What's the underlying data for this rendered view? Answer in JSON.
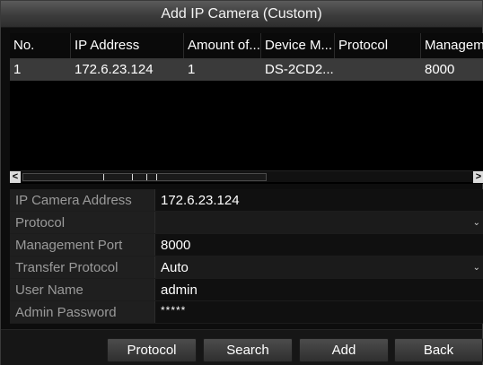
{
  "dialog": {
    "title": "Add IP Camera (Custom)"
  },
  "table": {
    "columns": [
      "No.",
      "IP Address",
      "Amount of...",
      "Device M...",
      "Protocol",
      "Managem"
    ],
    "rows": [
      [
        "1",
        "172.6.23.124",
        "1",
        "DS-2CD2...",
        "",
        "8000"
      ]
    ]
  },
  "scrollbar": {
    "left_arrow": "<",
    "right_arrow": ">"
  },
  "form": {
    "ip_address": {
      "label": "IP Camera Address",
      "value": "172.6.23.124"
    },
    "protocol": {
      "label": "Protocol",
      "value": ""
    },
    "management_port": {
      "label": "Management Port",
      "value": "8000"
    },
    "transfer_protocol": {
      "label": "Transfer Protocol",
      "value": "Auto"
    },
    "user_name": {
      "label": "User Name",
      "value": "admin"
    },
    "admin_password": {
      "label": "Admin Password",
      "value": "*****"
    }
  },
  "buttons": {
    "protocol": "Protocol",
    "search": "Search",
    "add": "Add",
    "back": "Back"
  },
  "icons": {
    "dropdown": "chevron-down-icon"
  }
}
